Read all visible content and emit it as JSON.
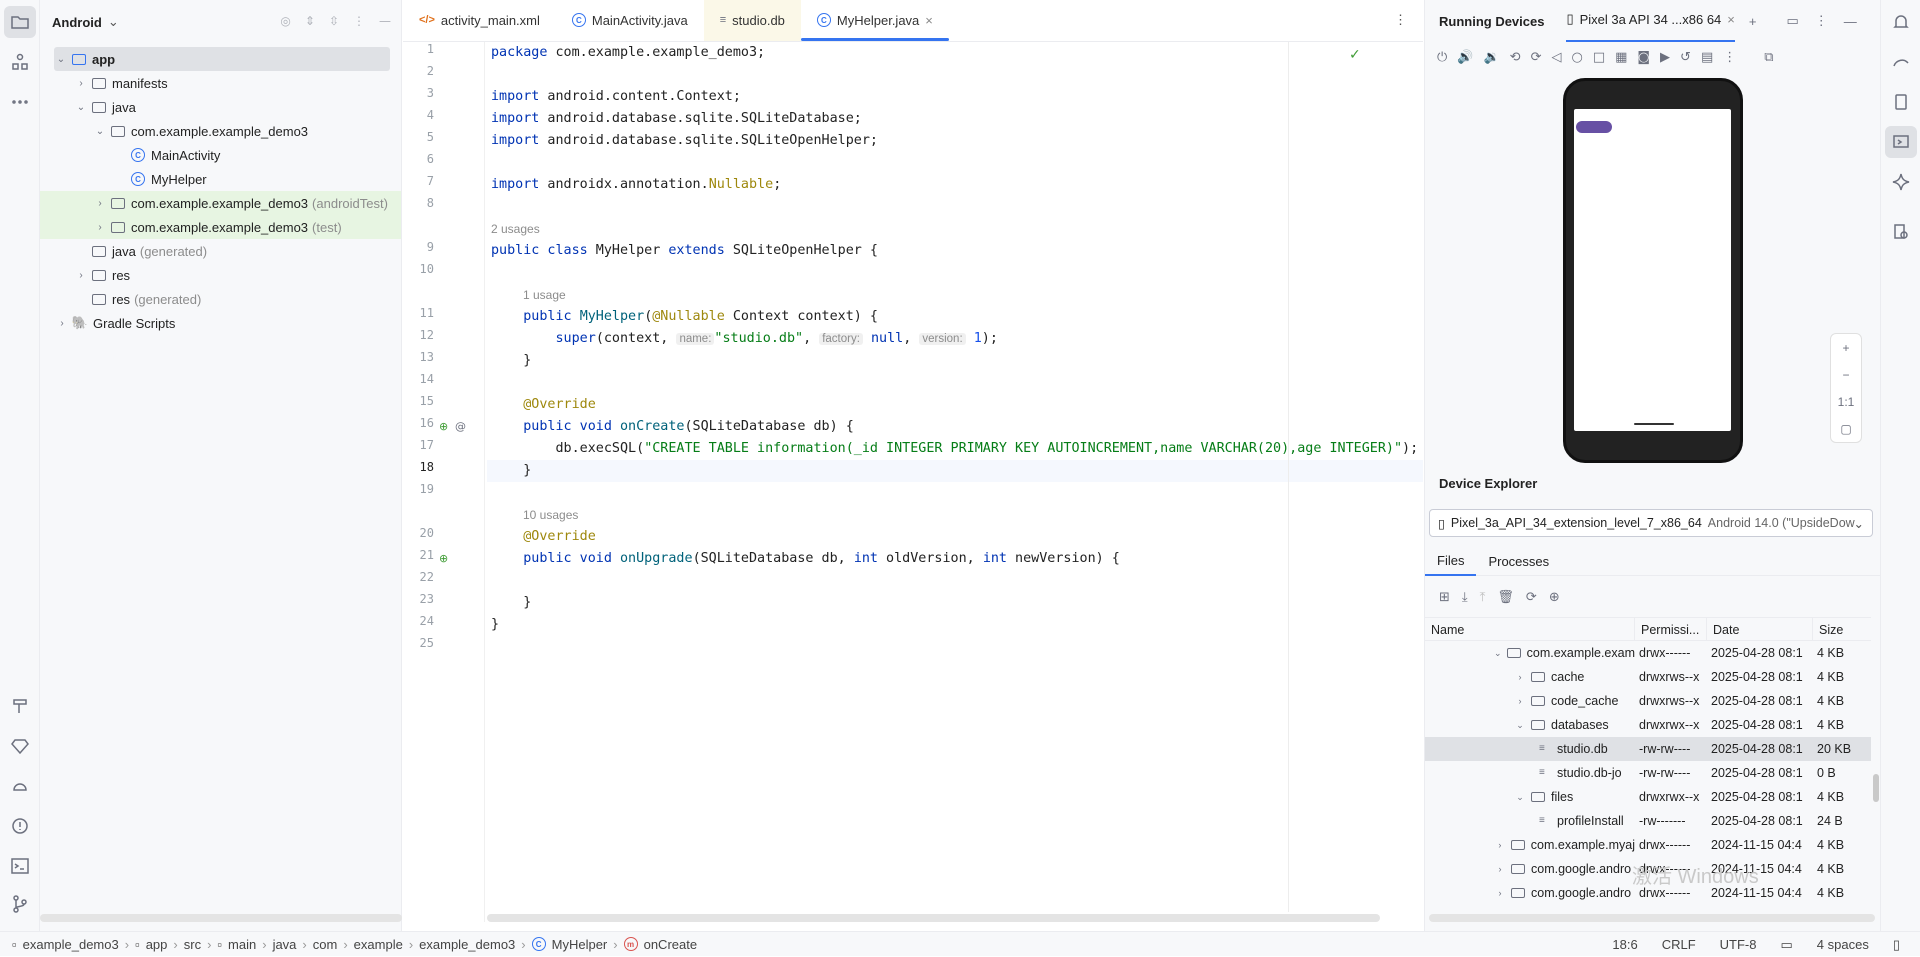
{
  "left_toolbar": {
    "icons": [
      "folder-icon",
      "structure-icon",
      "more-icon",
      "build-icon",
      "gem-icon",
      "android-icon",
      "problems-icon",
      "terminal-icon",
      "git-icon"
    ]
  },
  "project": {
    "view_label": "Android",
    "tree": [
      {
        "label": "app",
        "muted": ""
      },
      {
        "label": "manifests",
        "muted": ""
      },
      {
        "label": "java",
        "muted": ""
      },
      {
        "label": "com.example.example_demo3",
        "muted": ""
      },
      {
        "label": "MainActivity",
        "muted": ""
      },
      {
        "label": "MyHelper",
        "muted": ""
      },
      {
        "label": "com.example.example_demo3",
        "muted": "(androidTest)"
      },
      {
        "label": "com.example.example_demo3",
        "muted": "(test)"
      },
      {
        "label": "java",
        "muted": "(generated)"
      },
      {
        "label": "res",
        "muted": ""
      },
      {
        "label": "res",
        "muted": "(generated)"
      },
      {
        "label": "Gradle Scripts",
        "muted": ""
      }
    ]
  },
  "editor": {
    "tabs": [
      {
        "label": "activity_main.xml",
        "icon": "</>"
      },
      {
        "label": "MainActivity.java",
        "icon": "C"
      },
      {
        "label": "studio.db",
        "icon": "≡"
      },
      {
        "label": "MyHelper.java",
        "icon": "C"
      }
    ],
    "close_glyph": "×",
    "more_glyph": "⋮",
    "line_numbers": [
      "1",
      "2",
      "3",
      "4",
      "5",
      "6",
      "7",
      "8",
      "9",
      "10",
      "11",
      "12",
      "13",
      "14",
      "15",
      "16",
      "17",
      "18",
      "19",
      "20",
      "21",
      "22",
      "23",
      "24",
      "25"
    ],
    "hints": {
      "h1": "2 usages",
      "h2": "1 usage",
      "h3": "10 usages"
    },
    "code": {
      "l1a": "package",
      "l1b": " com.example.example_demo3;",
      "l3a": "import",
      "l3b": " android.content.Context;",
      "l4a": "import",
      "l4b": " android.database.sqlite.SQLiteDatabase;",
      "l5a": "import",
      "l5b": " android.database.sqlite.SQLiteOpenHelper;",
      "l7a": "import",
      "l7b": " androidx.annotation.",
      "l7c": "Nullable",
      "l7d": ";",
      "l9a": "public class",
      "l9b": " MyHelper ",
      "l9c": "extends",
      "l9d": " SQLiteOpenHelper {",
      "l11a": "    public ",
      "l11b": "MyHelper",
      "l11c": "(",
      "l11d": "@Nullable",
      "l11e": " Context context) {",
      "l12a": "        super",
      "l12b": "(context, ",
      "l12c": "name:",
      "l12d": "\"studio.db\"",
      "l12e": ", ",
      "l12f": "factory:",
      "l12g": " null",
      "l12h": ", ",
      "l12i": "version:",
      "l12j": " 1",
      "l12k": ");",
      "l13": "    }",
      "l15": "    @Override",
      "l16a": "    public void ",
      "l16b": "onCreate",
      "l16c": "(SQLiteDatabase db) {",
      "l17a": "        db.execSQL(",
      "l17b": "\"CREATE TABLE information(_id INTEGER PRIMARY KEY AUTOINCREMENT,name VARCHAR(20),age INTEGER)\"",
      "l17c": ");",
      "l18": "    }",
      "l20": "    @Override",
      "l21a": "    public void ",
      "l21b": "onUpgrade",
      "l21c": "(SQLiteDatabase db, ",
      "l21d": "int",
      "l21e": " oldVersion, ",
      "l21f": "int",
      "l21g": " newVersion) {",
      "l23": "    }",
      "l24": "}"
    }
  },
  "running_devices": {
    "title": "Running Devices",
    "device_tab": "Pixel 3a API 34 ...x86 64",
    "zoom": {
      "plus": "+",
      "minus": "−",
      "ratio": "1:1"
    }
  },
  "device_explorer": {
    "title": "Device Explorer",
    "device": "Pixel_3a_API_34_extension_level_7_x86_64",
    "device_os": "Android 14.0 (\"UpsideDow",
    "tabs": [
      "Files",
      "Processes"
    ],
    "columns": [
      "Name",
      "Permissi...",
      "Date",
      "Size"
    ],
    "rows": [
      {
        "name": "com.example.exam",
        "perm": "drwx------",
        "date": "2025-04-28 08:1",
        "size": "4 KB",
        "type": "folder",
        "state": "open"
      },
      {
        "name": "cache",
        "perm": "drwxrws--x",
        "date": "2025-04-28 08:1",
        "size": "4 KB",
        "type": "folder",
        "state": "closed"
      },
      {
        "name": "code_cache",
        "perm": "drwxrws--x",
        "date": "2025-04-28 08:1",
        "size": "4 KB",
        "type": "folder",
        "state": "closed"
      },
      {
        "name": "databases",
        "perm": "drwxrwx--x",
        "date": "2025-04-28 08:1",
        "size": "4 KB",
        "type": "folder",
        "state": "open"
      },
      {
        "name": "studio.db",
        "perm": "-rw-rw----",
        "date": "2025-04-28 08:1",
        "size": "20 KB",
        "type": "file",
        "state": ""
      },
      {
        "name": "studio.db-jo",
        "perm": "-rw-rw----",
        "date": "2025-04-28 08:1",
        "size": "0 B",
        "type": "file",
        "state": ""
      },
      {
        "name": "files",
        "perm": "drwxrwx--x",
        "date": "2025-04-28 08:1",
        "size": "4 KB",
        "type": "folder",
        "state": "open"
      },
      {
        "name": "profileInstall",
        "perm": "-rw-------",
        "date": "2025-04-28 08:1",
        "size": "24 B",
        "type": "file",
        "state": ""
      },
      {
        "name": "com.example.myaj",
        "perm": "drwx------",
        "date": "2024-11-15 04:4",
        "size": "4 KB",
        "type": "folder",
        "state": "closed"
      },
      {
        "name": "com.google.andro",
        "perm": "drwx------",
        "date": "2024-11-15 04:4",
        "size": "4 KB",
        "type": "folder",
        "state": "closed"
      },
      {
        "name": "com.google.andro",
        "perm": "drwx------",
        "date": "2024-11-15 04:4",
        "size": "4 KB",
        "type": "folder",
        "state": "closed"
      }
    ]
  },
  "status_bar": {
    "breadcrumbs": [
      "example_demo3",
      "app",
      "src",
      "main",
      "java",
      "com",
      "example",
      "example_demo3",
      "MyHelper",
      "onCreate"
    ],
    "position": "18:6",
    "line_sep": "CRLF",
    "encoding": "UTF-8",
    "indent": "4 spaces"
  },
  "watermark": "激活 Windows"
}
